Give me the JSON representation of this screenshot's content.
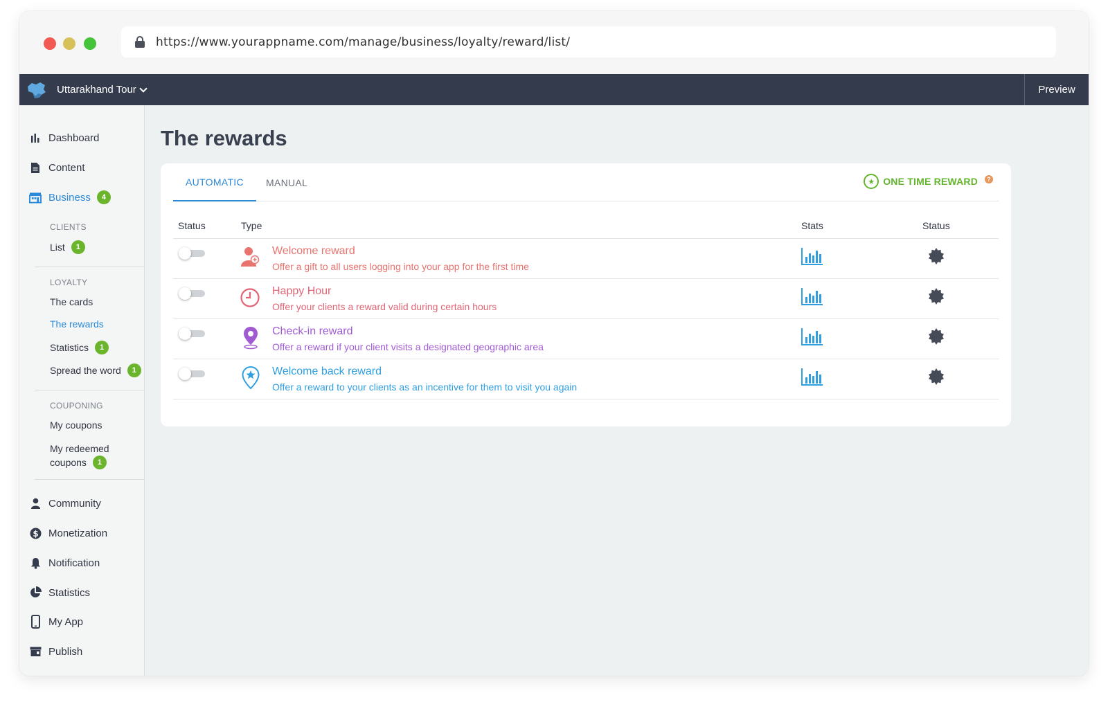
{
  "browser": {
    "url": "https://www.yourappname.com/manage/business/loyalty/reward/list/"
  },
  "topbar": {
    "app_name": "Uttarakhand Tour",
    "preview_label": "Preview"
  },
  "sidebar": {
    "items": [
      {
        "label": "Dashboard",
        "icon": "bar-chart-icon"
      },
      {
        "label": "Content",
        "icon": "document-icon"
      },
      {
        "label": "Business",
        "icon": "store-icon",
        "badge": "4"
      },
      {
        "label": "Community",
        "icon": "user-icon"
      },
      {
        "label": "Monetization",
        "icon": "dollar-icon"
      },
      {
        "label": "Notification",
        "icon": "bell-icon"
      },
      {
        "label": "Statistics",
        "icon": "pie-chart-icon"
      },
      {
        "label": "My App",
        "icon": "phone-icon"
      },
      {
        "label": "Publish",
        "icon": "shop-icon"
      }
    ],
    "clients": {
      "heading": "CLIENTS",
      "list_label": "List",
      "list_badge": "1"
    },
    "loyalty": {
      "heading": "LOYALTY",
      "cards_label": "The cards",
      "rewards_label": "The rewards",
      "statistics_label": "Statistics",
      "statistics_badge": "1",
      "spread_label": "Spread the word",
      "spread_badge": "1"
    },
    "couponing": {
      "heading": "COUPONING",
      "my_coupons_label": "My coupons",
      "redeemed_line1": "My redeemed",
      "redeemed_line2": "coupons",
      "redeemed_badge": "1"
    }
  },
  "main": {
    "title": "The rewards",
    "tabs": [
      {
        "label": "AUTOMATIC",
        "active": true
      },
      {
        "label": "MANUAL",
        "active": false
      }
    ],
    "one_time_reward_label": "ONE TIME REWARD",
    "help_glyph": "?",
    "table": {
      "headers": {
        "status": "Status",
        "type": "Type",
        "stats": "Stats",
        "status2": "Status"
      },
      "rows": [
        {
          "title": "Welcome reward",
          "desc": "Offer a gift to all users logging into your app for the first time",
          "color": "#e8736f",
          "icon": "user-plus-icon",
          "enabled": false
        },
        {
          "title": "Happy Hour",
          "desc": "Offer your clients a reward valid during certain hours",
          "color": "#e26474",
          "icon": "clock-icon",
          "enabled": false
        },
        {
          "title": "Check-in reward",
          "desc": "Offer a reward if your client visits a designated geographic area",
          "color": "#a05bd3",
          "icon": "location-pin-icon",
          "enabled": false
        },
        {
          "title": "Welcome back reward",
          "desc": "Offer a reward to your clients as an incentive for them to visit you again",
          "color": "#2f9fe0",
          "icon": "star-pin-icon",
          "enabled": false
        }
      ]
    }
  },
  "colors": {
    "accent": "#2a8ad9",
    "badge_green": "#6bb52d",
    "topbar": "#343b4c"
  }
}
